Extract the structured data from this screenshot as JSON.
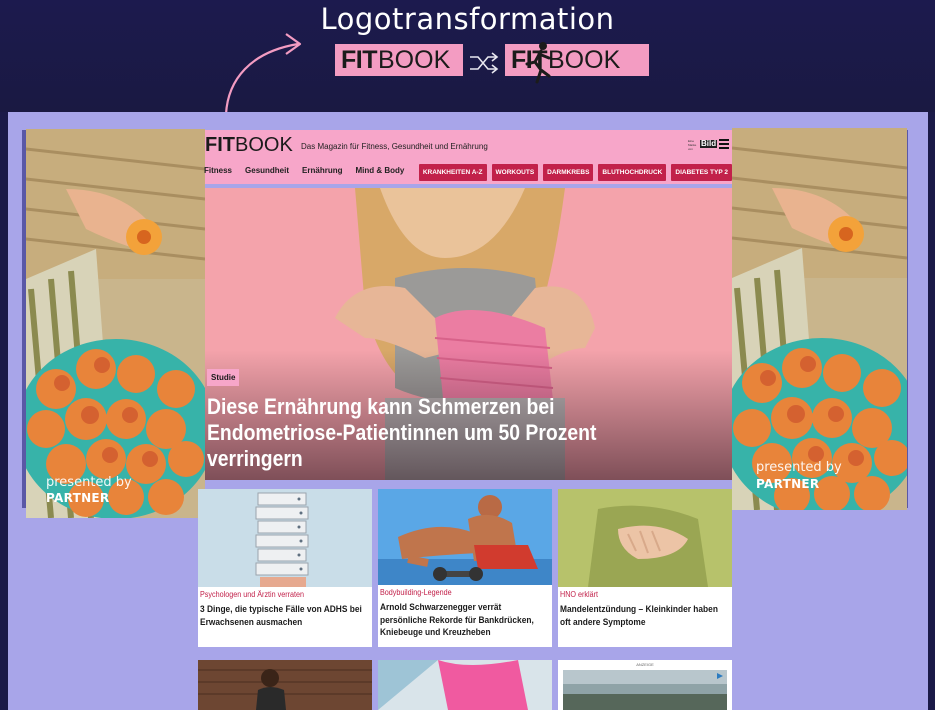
{
  "header": {
    "title": "Logotransformation",
    "old_logo": {
      "fit": "FIT",
      "book": "BOOK"
    },
    "new_logo": {
      "fit": "FIT",
      "book": "BOOK"
    }
  },
  "side_ads": {
    "presented_by": "presented by",
    "partner": "PARTNER"
  },
  "site": {
    "logo": {
      "fit": "FIT",
      "book": "BOOK"
    },
    "tagline": "Das Magazin für Fitness, Gesundheit und Ernährung",
    "bild_mark": {
      "small": "Eine Marke von",
      "brand": "Bild"
    },
    "nav": [
      "Fitness",
      "Gesundheit",
      "Ernährung",
      "Mind & Body"
    ],
    "chips": [
      "KRANKHEITEN A-Z",
      "WORKOUTS",
      "DARMKREBS",
      "BLUTHOCHDRUCK",
      "DIABETES TYP 2"
    ]
  },
  "hero": {
    "tag": "Studie",
    "headline": "Diese Ernährung kann Schmerzen bei Endometriose-Patientinnen um 50 Prozent verringern"
  },
  "tiles": [
    {
      "kicker": "Psychologen und Ärztin verraten",
      "title": "3 Dinge, die typische Fälle von ADHS bei Erwachsenen ausmachen"
    },
    {
      "kicker": "Bodybuilding-Legende",
      "title": "Arnold Schwarzenegger verrät persönliche Rekorde für Bankdrücken, Kniebeuge und Kreuzheben"
    },
    {
      "kicker": "HNO erklärt",
      "title": "Mandelentzündung – Kleinkinder haben oft andere Symptome"
    }
  ],
  "ad_label": "ANZEIGE",
  "colors": {
    "background": "#1b1a48",
    "canvas": "#a8a5e9",
    "pink": "#f7a6c9",
    "accent": "#c2214a"
  }
}
